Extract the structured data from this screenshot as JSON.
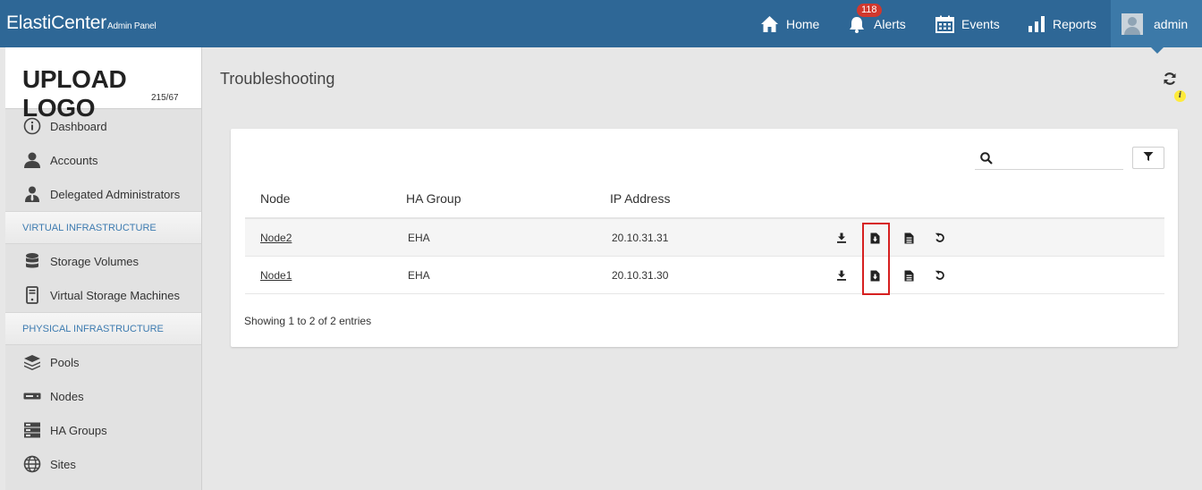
{
  "header": {
    "brand": "ElastiCenter",
    "brand_sub": "Admin Panel",
    "nav": {
      "home": "Home",
      "alerts": "Alerts",
      "alerts_count": "118",
      "events": "Events",
      "reports": "Reports",
      "user": "admin"
    }
  },
  "sidebar": {
    "logo_text": "UPLOAD LOGO",
    "logo_size": "215/67",
    "items": {
      "dashboard": "Dashboard",
      "accounts": "Accounts",
      "delegated": "Delegated Administrators",
      "section_virtual": "VIRTUAL INFRASTRUCTURE",
      "storage_volumes": "Storage Volumes",
      "vsm": "Virtual Storage Machines",
      "section_physical": "PHYSICAL INFRASTRUCTURE",
      "pools": "Pools",
      "nodes": "Nodes",
      "ha_groups": "HA Groups",
      "sites": "Sites"
    }
  },
  "main": {
    "title": "Troubleshooting",
    "search": {
      "value": "",
      "placeholder": ""
    },
    "table": {
      "headers": {
        "node": "Node",
        "ha_group": "HA Group",
        "ip": "IP Address"
      },
      "rows": [
        {
          "node": "Node2",
          "ha_group": "EHA",
          "ip": "20.10.31.31"
        },
        {
          "node": "Node1",
          "ha_group": "EHA",
          "ip": "20.10.31.30"
        }
      ]
    },
    "showing": "Showing 1 to 2 of 2 entries"
  },
  "colors": {
    "topbar": "#2e6796",
    "accent": "#3d7bb0",
    "badge": "#d0382e",
    "highlight": "#d62020"
  },
  "icons": [
    "home-icon",
    "bell-icon",
    "calendar-icon",
    "bar-chart-icon",
    "user-avatar-icon",
    "refresh-icon",
    "info-icon",
    "search-icon",
    "filter-icon",
    "download-icon",
    "file-download-icon",
    "document-icon",
    "restart-icon"
  ]
}
